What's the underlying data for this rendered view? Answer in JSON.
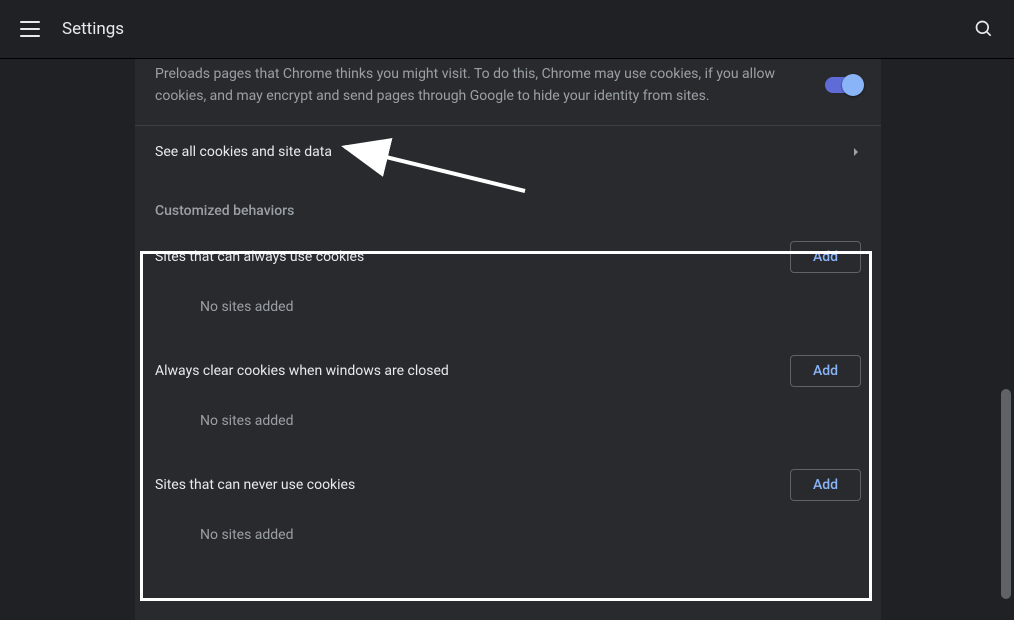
{
  "header": {
    "title": "Settings"
  },
  "preload": {
    "description": "Preloads pages that Chrome thinks you might visit. To do this, Chrome may use cookies, if you allow cookies, and may encrypt and send pages through Google to hide your identity from sites.",
    "toggle_on": true
  },
  "see_all": {
    "label": "See all cookies and site data"
  },
  "customized": {
    "heading": "Customized behaviors"
  },
  "groups": {
    "always": {
      "title": "Sites that can always use cookies",
      "add_label": "Add",
      "empty": "No sites added"
    },
    "clear_on_close": {
      "title": "Always clear cookies when windows are closed",
      "add_label": "Add",
      "empty": "No sites added"
    },
    "never": {
      "title": "Sites that can never use cookies",
      "add_label": "Add",
      "empty": "No sites added"
    }
  }
}
